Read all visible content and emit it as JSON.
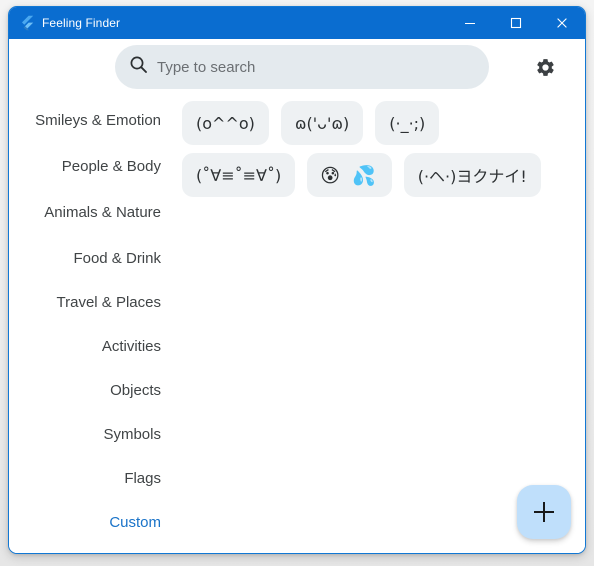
{
  "window": {
    "title": "Feeling Finder",
    "app_icon": "flutter-logo-icon",
    "titlebar_color": "#0a6dd0",
    "border_color": "#1278d4",
    "controls": [
      {
        "name": "minimize",
        "icon": "minimize-icon"
      },
      {
        "name": "maximize",
        "icon": "maximize-icon"
      },
      {
        "name": "close",
        "icon": "close-icon"
      }
    ]
  },
  "search": {
    "icon": "search-icon",
    "placeholder": "Type to search",
    "value": ""
  },
  "settings": {
    "icon": "gear-icon",
    "label": "Settings"
  },
  "sidebar": {
    "selected": "Custom",
    "selected_color": "#1a73c8",
    "items": [
      {
        "label": "Smileys & Emotion",
        "selected": false
      },
      {
        "label": "People & Body",
        "selected": false
      },
      {
        "label": "Animals & Nature",
        "selected": false
      },
      {
        "label": "Food & Drink",
        "selected": false
      },
      {
        "label": "Travel & Places",
        "selected": false
      },
      {
        "label": "Activities",
        "selected": false
      },
      {
        "label": "Objects",
        "selected": false
      },
      {
        "label": "Symbols",
        "selected": false
      },
      {
        "label": "Flags",
        "selected": false
      },
      {
        "label": "Custom",
        "selected": true
      }
    ]
  },
  "content": {
    "rows": [
      {
        "chips": [
          {
            "text": "(o^^o)",
            "type": "kaomoji"
          },
          {
            "text": "ɷ('ᴗ'ɷ)",
            "type": "kaomoji"
          },
          {
            "text": "(·_·;)",
            "type": "kaomoji"
          }
        ]
      },
      {
        "chips": [
          {
            "text": "(˚∀≡˚≡∀˚)",
            "type": "kaomoji"
          },
          {
            "text": "😰 💦",
            "type": "emoji"
          },
          {
            "text": "(·ヘ·)ヨクナイ!",
            "type": "kaomoji"
          }
        ]
      }
    ],
    "chip_background": "#eef1f3"
  },
  "fab": {
    "icon": "plus-icon",
    "label": "Add",
    "color": "#bfdffb"
  }
}
